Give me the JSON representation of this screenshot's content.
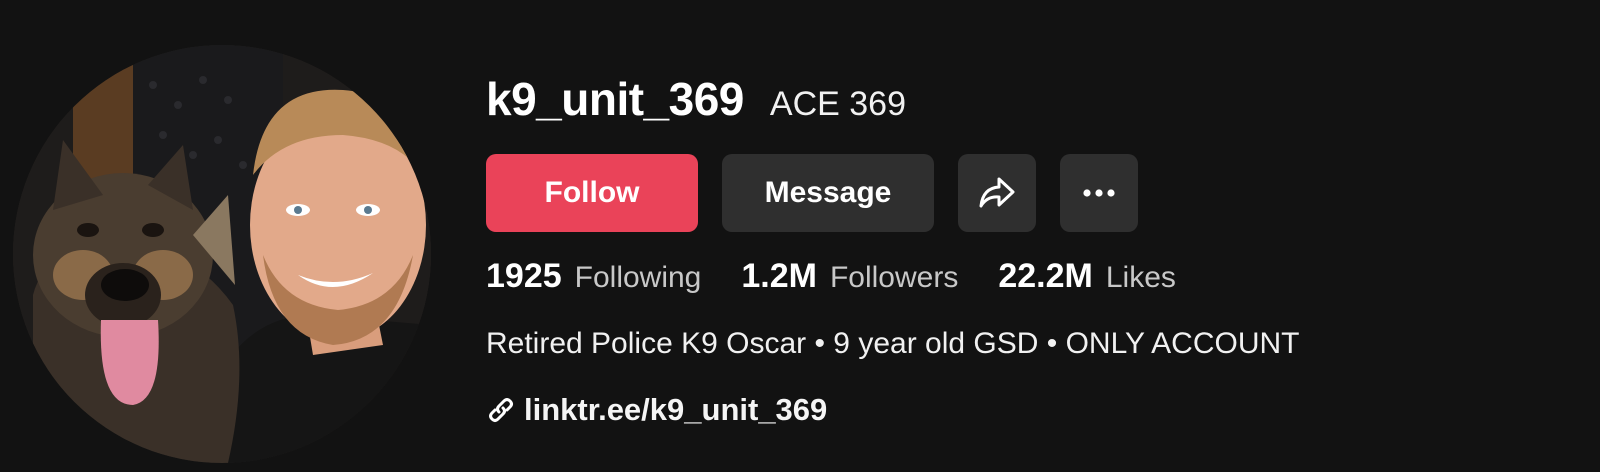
{
  "profile": {
    "username": "k9_unit_369",
    "nickname": "ACE 369",
    "bio": "Retired Police K9 Oscar • 9 year old GSD • ONLY ACCOUNT",
    "link": "linktr.ee/k9_unit_369"
  },
  "actions": {
    "follow_label": "Follow",
    "message_label": "Message",
    "share_icon": "share-arrow-icon",
    "more_icon": "more-dots-icon"
  },
  "stats": [
    {
      "value": "1925",
      "label": "Following"
    },
    {
      "value": "1.2M",
      "label": "Followers"
    },
    {
      "value": "22.2M",
      "label": "Likes"
    }
  ],
  "colors": {
    "background": "#121212",
    "follow": "#ea4359",
    "secondary_button": "#2f2f2f"
  }
}
